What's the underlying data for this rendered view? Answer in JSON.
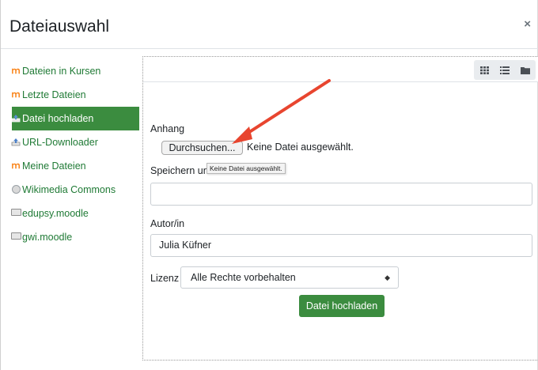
{
  "dialog": {
    "title": "Dateiauswahl",
    "close_icon": "close-icon"
  },
  "sidebar": {
    "items": [
      {
        "label": "Dateien in Kursen",
        "icon": "moodle-icon",
        "active": false
      },
      {
        "label": "Letzte Dateien",
        "icon": "moodle-icon",
        "active": false
      },
      {
        "label": "Datei hochladen",
        "icon": "upload-icon",
        "active": true
      },
      {
        "label": "URL-Downloader",
        "icon": "url-downloader-icon",
        "active": false
      },
      {
        "label": "Meine Dateien",
        "icon": "moodle-icon",
        "active": false
      },
      {
        "label": "Wikimedia Commons",
        "icon": "wikimedia-icon",
        "active": false
      },
      {
        "label": "edupsy.moodle",
        "icon": "drive-icon",
        "active": false
      },
      {
        "label": "gwi.moodle",
        "icon": "drive-icon",
        "active": false
      }
    ]
  },
  "toolbar": {
    "views": [
      "icons-view-icon",
      "list-view-icon",
      "tree-view-icon"
    ]
  },
  "form": {
    "attachment_label": "Anhang",
    "browse_label": "Durchsuchen...",
    "no_file_text": "Keine Datei ausgewählt.",
    "tooltip_text": "Keine Datei ausgewählt.",
    "save_as_label": "Speichern unter",
    "save_as_value": "",
    "author_label": "Autor/in",
    "author_value": "Julia Küfner",
    "license_label": "Lizenz",
    "license_value": "Alle Rechte vorbehalten",
    "submit_label": "Datei hochladen"
  },
  "colors": {
    "brand_green": "#3b8c3f",
    "link_green": "#1f7a35",
    "annotation_arrow": "#e8452f",
    "moodle_orange": "#f98012"
  }
}
